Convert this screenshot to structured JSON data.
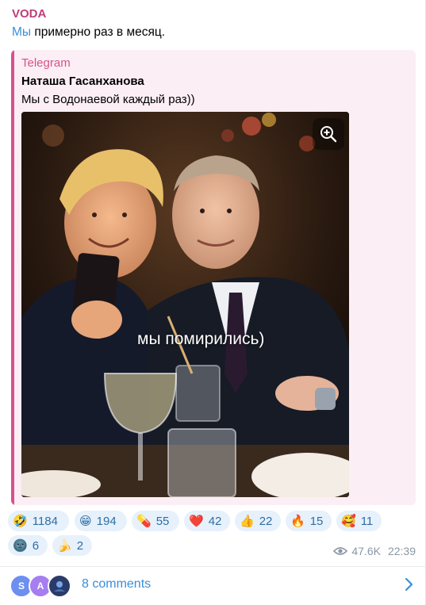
{
  "post": {
    "channel_name": "VODA",
    "body_mention": "Мы",
    "body_text": " примерно раз в месяц."
  },
  "quote": {
    "source": "Telegram",
    "author": "Наташа Гасанханова",
    "text": "Мы с Водонаевой каждый раз))",
    "photo_caption": "мы помирились)"
  },
  "reactions": [
    {
      "emoji": "🤣",
      "count": "1184"
    },
    {
      "emoji": "😁",
      "count": "194"
    },
    {
      "emoji": "💊",
      "count": "55"
    },
    {
      "emoji": "❤️",
      "count": "42"
    },
    {
      "emoji": "👍",
      "count": "22"
    },
    {
      "emoji": "🔥",
      "count": "15"
    },
    {
      "emoji": "🥰",
      "count": "11"
    },
    {
      "emoji": "🌚",
      "count": "6"
    },
    {
      "emoji": "🍌",
      "count": "2"
    }
  ],
  "meta": {
    "views": "47.6K",
    "time": "22:39"
  },
  "comments": {
    "label": "8 comments",
    "avatars": [
      {
        "letter": "S",
        "color": "#6d8ff0"
      },
      {
        "letter": "A",
        "color": "#a57ef0"
      },
      {
        "letter": "",
        "color": "#2a3b6a"
      }
    ]
  },
  "colors": {
    "channel": "#c03d78",
    "quote_accent": "#d6528c",
    "quote_bg": "#fbeef4",
    "link": "#3a8ed8",
    "reaction_bg": "#e6f1fb",
    "reaction_text": "#2f6ea5",
    "meta": "#8a98a5"
  },
  "icons": {
    "zoom": "zoom-in-icon",
    "views": "eye-icon",
    "chevron": "chevron-right-icon"
  }
}
